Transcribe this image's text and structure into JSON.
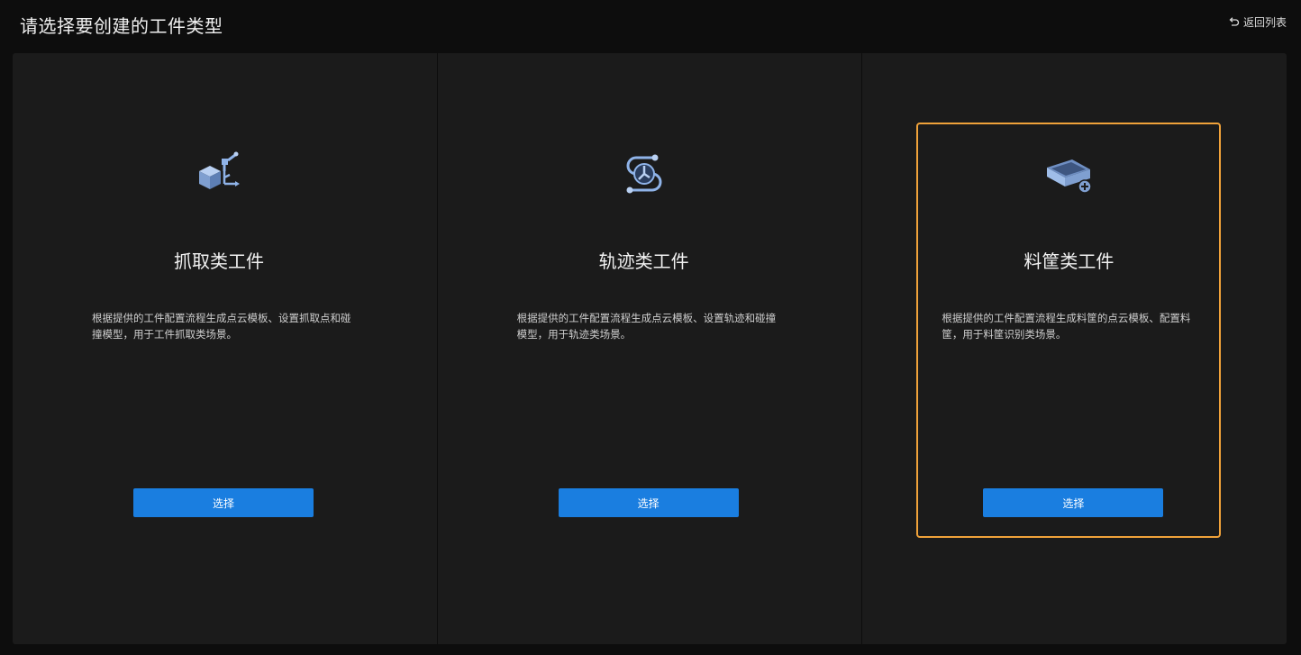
{
  "header": {
    "title": "请选择要创建的工件类型",
    "back_label": "返回列表"
  },
  "cards": [
    {
      "title": "抓取类工件",
      "description": "根据提供的工件配置流程生成点云模板、设置抓取点和碰撞模型，用于工件抓取类场景。",
      "button": "选择",
      "icon": "grasp-workpiece-icon",
      "selected": false
    },
    {
      "title": "轨迹类工件",
      "description": "根据提供的工件配置流程生成点云模板、设置轨迹和碰撞模型，用于轨迹类场景。",
      "button": "选择",
      "icon": "trajectory-workpiece-icon",
      "selected": false
    },
    {
      "title": "料筐类工件",
      "description": "根据提供的工件配置流程生成料筐的点云模板、配置料筐，用于料筐识别类场景。",
      "button": "选择",
      "icon": "bin-workpiece-icon",
      "selected": true
    }
  ],
  "colors": {
    "accent": "#1a7ee0",
    "selected_border": "#f0a23a",
    "icon": "#8fb3e8"
  }
}
